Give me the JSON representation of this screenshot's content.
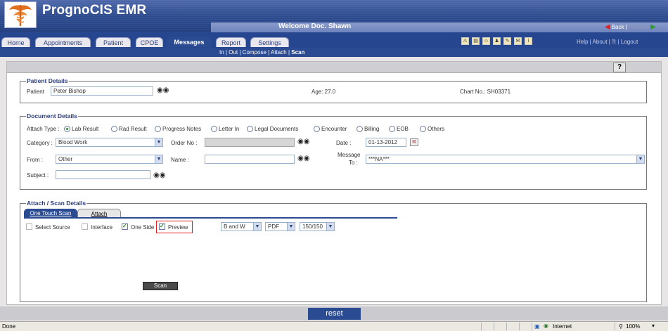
{
  "app": {
    "title": "PrognoCIS EMR",
    "welcome": "Welcome Doc. Shawn"
  },
  "nav": {
    "back_label": "Back |",
    "forward_label": "Forward"
  },
  "tabs": [
    {
      "label": "Home"
    },
    {
      "label": "Appointments"
    },
    {
      "label": "Patient"
    },
    {
      "label": "CPOE"
    },
    {
      "label": "Messages"
    },
    {
      "label": "Report"
    },
    {
      "label": "Settings"
    }
  ],
  "toolbar_links": "Help  |  About  |  ",
  "toolbar_logout": "  |  Logout",
  "subnav": {
    "in": "In",
    "out": "Out",
    "compose": "Compose",
    "attach": "Attach",
    "scan": "Scan",
    "sep": "|"
  },
  "help_button": "?",
  "patient_details": {
    "legend": "Patient Details",
    "patient_label": "Patient",
    "patient_value": "Peter Bishop",
    "age": "Age: 27.0",
    "chart": "Chart No.: SH03371"
  },
  "document_details": {
    "legend": "Document Details",
    "attach_type_label": "Attach Type :",
    "attach_types": [
      "Lab Result",
      "Rad Result",
      "Progress Notes",
      "Letter In",
      "Legal Documents",
      "Encounter",
      "Billing",
      "EOB",
      "Others"
    ],
    "category_label": "Category :",
    "category_value": "Blood Work",
    "order_no_label": "Order No :",
    "date_label": "Date :",
    "date_value": "01-13-2012",
    "from_label": "From :",
    "from_value": "Other",
    "name_label": "Name :",
    "message_label": "Message",
    "message_label2": "To :",
    "message_value": "***NA***",
    "subject_label": "Subject :"
  },
  "attach_scan": {
    "legend": "Attach / Scan Details",
    "tab_one_touch": "One Touch Scan",
    "tab_attach": "Attach",
    "select_source": "Select Source",
    "interface": "Interface",
    "one_side": "One Side",
    "preview": "Preview",
    "color_value": "B and W",
    "format_value": "PDF",
    "dpi_value": "150/150",
    "scan_button": "Scan"
  },
  "footer": {
    "reset": "reset"
  },
  "status": {
    "left": "Done",
    "zone": "Internet",
    "zoom": "100%"
  },
  "colors": {
    "brand": "#2a4a92",
    "highlight": "#e21b1b"
  }
}
